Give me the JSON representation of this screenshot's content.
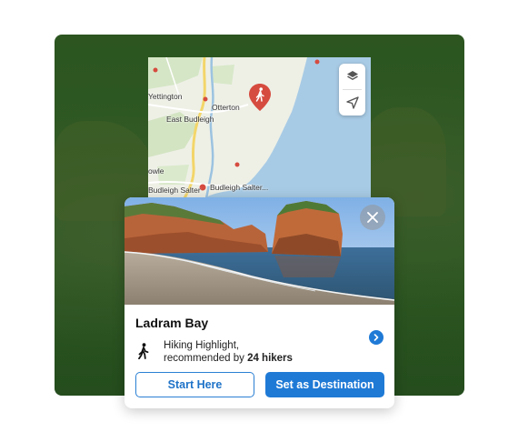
{
  "map": {
    "labels": {
      "yettington": "Yettington",
      "east_budleigh": "East Budleigh",
      "otterton": "Otterton",
      "owle": "owle",
      "budleigh_salterton": "Budleigh Salter",
      "budleigh_salterton_2": "Budleigh Salter..."
    },
    "controls": {
      "layers": "layers-icon",
      "locate": "location-arrow-icon"
    },
    "colors": {
      "sea": "#a8cbe5",
      "land": "#eef0e6",
      "park": "#cfe2bf",
      "road": "#f3d66a",
      "pin": "#d64b3f"
    }
  },
  "card": {
    "title": "Ladram Bay",
    "description_line1": "Hiking Highlight,",
    "description_line2_prefix": "recommended by",
    "description_line2_bold": "24 hikers",
    "buttons": {
      "start": "Start Here",
      "destination": "Set as Destination"
    }
  },
  "colors": {
    "accent": "#1f7ad6",
    "background_overlay": "#2c5520"
  }
}
